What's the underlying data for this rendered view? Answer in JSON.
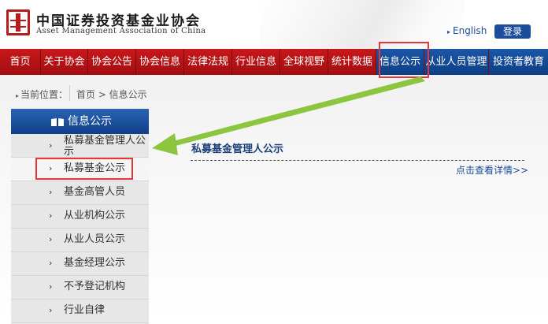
{
  "header": {
    "logo_cn": "中国证券投资基金业协会",
    "logo_en": "Asset Management Association of China",
    "lang_link": "English",
    "login_label": "登录"
  },
  "nav": {
    "items": [
      {
        "label": "首页"
      },
      {
        "label": "关于协会"
      },
      {
        "label": "协会公告"
      },
      {
        "label": "协会信息"
      },
      {
        "label": "法律法规"
      },
      {
        "label": "行业信息"
      },
      {
        "label": "全球视野"
      },
      {
        "label": "统计数据"
      },
      {
        "label": "信息公示"
      },
      {
        "label": "从业人员管理"
      },
      {
        "label": "投资者教育"
      }
    ]
  },
  "breadcrumb": {
    "prefix": "当前位置：",
    "path": "首页 > 信息公示"
  },
  "sidebar": {
    "title": "信息公示",
    "items": [
      {
        "label": "私募基金管理人公示"
      },
      {
        "label": "私募基金公示"
      },
      {
        "label": "基金高管人员"
      },
      {
        "label": "从业机构公示"
      },
      {
        "label": "从业人员公示"
      },
      {
        "label": "基金经理公示"
      },
      {
        "label": "不予登记机构"
      },
      {
        "label": "行业自律"
      }
    ]
  },
  "content": {
    "title": "私募基金管理人公示",
    "more_link": "点击查看详情>>"
  },
  "colors": {
    "nav_red": "#c8181b",
    "nav_blue": "#1a56a8",
    "highlight_box": "#e8353a",
    "arrow_green": "#8cc63f"
  }
}
